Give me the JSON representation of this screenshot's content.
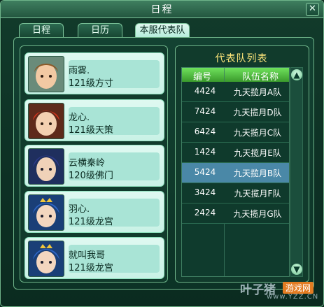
{
  "window": {
    "title": "日程"
  },
  "tabs": [
    {
      "label": "日程",
      "active": false
    },
    {
      "label": "日历",
      "active": false
    },
    {
      "label": "本服代表队",
      "active": true
    }
  ],
  "members": [
    {
      "name": "雨雾.",
      "level": "121级方寸",
      "avatar": "portrait-brown-hair-icon"
    },
    {
      "name": "龙心.",
      "level": "121级天策",
      "avatar": "portrait-red-hair-icon"
    },
    {
      "name": "云横秦岭",
      "level": "120级佛门",
      "avatar": "portrait-blue-hair-icon"
    },
    {
      "name": "羽心.",
      "level": "121级龙宫",
      "avatar": "portrait-blue-crown-icon"
    },
    {
      "name": "就叫我哥",
      "level": "121级龙宫",
      "avatar": "portrait-blue-crown-icon"
    }
  ],
  "team_list": {
    "title": "代表队列表",
    "columns": [
      "编号",
      "队伍名称"
    ],
    "rows": [
      {
        "id": "4424",
        "name": "九天揽月A队"
      },
      {
        "id": "7424",
        "name": "九天揽月D队"
      },
      {
        "id": "6424",
        "name": "九天揽月C队"
      },
      {
        "id": "1424",
        "name": "九天揽月E队"
      },
      {
        "id": "5424",
        "name": "九天揽月B队",
        "selected": true
      },
      {
        "id": "3424",
        "name": "九天揽月F队"
      },
      {
        "id": "2424",
        "name": "九天揽月G队"
      }
    ]
  },
  "watermark": {
    "text": "叶子猪",
    "badge": "游戏网",
    "url": "www.YZZ.CN"
  },
  "colors": {
    "accent": "#ffe77a",
    "selected_row": "#4a88a7",
    "header": "#3a9a2c"
  }
}
